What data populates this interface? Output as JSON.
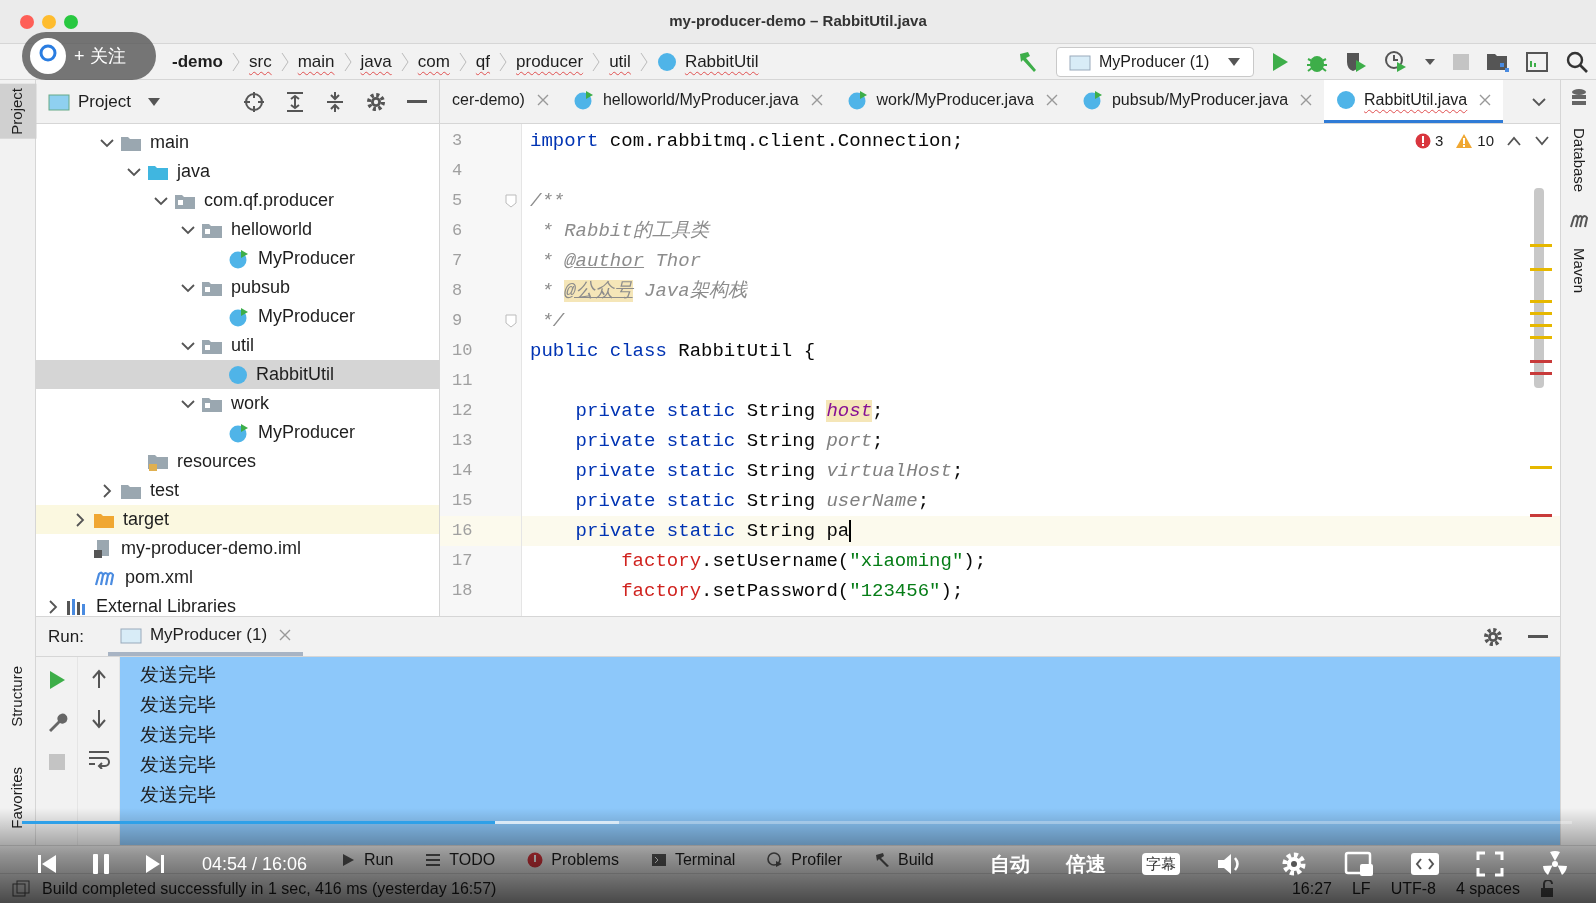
{
  "window": {
    "title": "my-producer-demo – RabbitUtil.java"
  },
  "breadcrumbs": [
    {
      "label": "-demo",
      "kind": "module"
    },
    {
      "label": "src",
      "kind": "folder"
    },
    {
      "label": "main",
      "kind": "folder"
    },
    {
      "label": "java",
      "kind": "folder"
    },
    {
      "label": "com",
      "kind": "folder"
    },
    {
      "label": "qf",
      "kind": "folder"
    },
    {
      "label": "producer",
      "kind": "folder"
    },
    {
      "label": "util",
      "kind": "folder"
    },
    {
      "label": "RabbitUtil",
      "kind": "class"
    }
  ],
  "run_config": {
    "label": "MyProducer (1)"
  },
  "project_panel": {
    "title": "Project",
    "sections": [
      {
        "items": [
          {
            "label": "main",
            "kind": "folder",
            "expanded": true,
            "selected": false,
            "children": [
              {
                "label": "java",
                "kind": "source-folder",
                "expanded": true,
                "selected": false,
                "children": [
                  {
                    "label": "com.qf.producer",
                    "kind": "package",
                    "expanded": true,
                    "selected": false,
                    "children": [
                      {
                        "label": "helloworld",
                        "kind": "package",
                        "expanded": true,
                        "selected": false,
                        "children": [
                          {
                            "label": "MyProducer",
                            "kind": "run-class",
                            "selected": false
                          }
                        ]
                      },
                      {
                        "label": "pubsub",
                        "kind": "package",
                        "expanded": true,
                        "selected": false,
                        "children": [
                          {
                            "label": "MyProducer",
                            "kind": "run-class",
                            "selected": false
                          }
                        ]
                      },
                      {
                        "label": "util",
                        "kind": "package",
                        "expanded": true,
                        "selected": false,
                        "children": [
                          {
                            "label": "RabbitUtil",
                            "kind": "class",
                            "selected": true
                          }
                        ]
                      },
                      {
                        "label": "work",
                        "kind": "package",
                        "expanded": true,
                        "selected": false,
                        "children": [
                          {
                            "label": "MyProducer",
                            "kind": "run-class",
                            "selected": false
                          }
                        ]
                      }
                    ]
                  }
                ]
              },
              {
                "label": "resources",
                "kind": "resources",
                "selected": false
              }
            ]
          },
          {
            "label": "test",
            "kind": "folder",
            "expanded": false,
            "selected": false
          }
        ]
      },
      {
        "items": [
          {
            "label": "target",
            "kind": "excluded-folder",
            "expanded": false,
            "selected": false
          },
          {
            "label": "my-producer-demo.iml",
            "kind": "iml",
            "selected": false
          },
          {
            "label": "pom.xml",
            "kind": "maven",
            "selected": false
          }
        ]
      },
      {
        "items": [
          {
            "label": "External Libraries",
            "kind": "library",
            "expanded": false,
            "selected": false
          }
        ]
      }
    ]
  },
  "editor_tabs": [
    {
      "label": "cer-demo)",
      "kind": "plain",
      "selected": false
    },
    {
      "label": "helloworld/MyProducer.java",
      "kind": "run-class",
      "selected": false
    },
    {
      "label": "work/MyProducer.java",
      "kind": "run-class",
      "selected": false
    },
    {
      "label": "pubsub/MyProducer.java",
      "kind": "run-class",
      "selected": false
    },
    {
      "label": "RabbitUtil.java",
      "kind": "class",
      "selected": true
    }
  ],
  "inspections": {
    "errors": "3",
    "warnings": "10"
  },
  "code_lines": [
    {
      "number": "3",
      "current": false,
      "tokens": [
        {
          "text": "import",
          "kind": "keyword"
        },
        {
          "text": " com.rabbitmq.client.Connection;",
          "kind": "plain"
        }
      ]
    },
    {
      "number": "4",
      "current": false
    },
    {
      "number": "5",
      "current": false,
      "fold": true,
      "tokens": [
        {
          "text": "/**",
          "kind": "comment"
        }
      ]
    },
    {
      "number": "6",
      "current": false,
      "tokens": [
        {
          "text": " * Rabbit的工具类",
          "kind": "comment"
        }
      ]
    },
    {
      "number": "7",
      "current": false,
      "tokens": [
        {
          "text": " * ",
          "kind": "comment"
        },
        {
          "text": "@author",
          "kind": "doctag"
        },
        {
          "text": " Thor",
          "kind": "comment"
        }
      ]
    },
    {
      "number": "8",
      "current": false,
      "tokens": [
        {
          "text": " * ",
          "kind": "comment"
        },
        {
          "text": "@公众号",
          "kind": "unknown-tag"
        },
        {
          "text": " Java架构栈",
          "kind": "comment"
        }
      ]
    },
    {
      "number": "9",
      "current": false,
      "fold": true,
      "tokens": [
        {
          "text": " */",
          "kind": "comment"
        }
      ]
    },
    {
      "number": "10",
      "current": false,
      "tokens": [
        {
          "text": "public class",
          "kind": "keyword"
        },
        {
          "text": " RabbitUtil {",
          "kind": "plain"
        }
      ]
    },
    {
      "number": "11",
      "current": false
    },
    {
      "number": "12",
      "current": false,
      "tokens": [
        {
          "text": "    private static",
          "kind": "keyword"
        },
        {
          "text": " String ",
          "kind": "plain"
        },
        {
          "text": "host",
          "kind": "field-highlight"
        },
        {
          "text": ";",
          "kind": "plain"
        }
      ]
    },
    {
      "number": "13",
      "current": false,
      "tokens": [
        {
          "text": "    private static",
          "kind": "keyword"
        },
        {
          "text": " String ",
          "kind": "plain"
        },
        {
          "text": "port",
          "kind": "field"
        },
        {
          "text": ";",
          "kind": "plain"
        }
      ]
    },
    {
      "number": "14",
      "current": false,
      "tokens": [
        {
          "text": "    private static",
          "kind": "keyword"
        },
        {
          "text": " String ",
          "kind": "plain"
        },
        {
          "text": "virtualHost",
          "kind": "field"
        },
        {
          "text": ";",
          "kind": "plain"
        }
      ]
    },
    {
      "number": "15",
      "current": false,
      "tokens": [
        {
          "text": "    private static",
          "kind": "keyword"
        },
        {
          "text": " String ",
          "kind": "plain"
        },
        {
          "text": "userName",
          "kind": "field"
        },
        {
          "text": ";",
          "kind": "plain"
        }
      ]
    },
    {
      "number": "16",
      "current": true,
      "tokens": [
        {
          "text": "    private static",
          "kind": "keyword"
        },
        {
          "text": " String pa",
          "kind": "plain"
        }
      ]
    },
    {
      "number": "17",
      "current": false,
      "tokens": [
        {
          "text": "        factory",
          "kind": "error"
        },
        {
          "text": ".setUsername(",
          "kind": "plain"
        },
        {
          "text": "\"xiaoming\"",
          "kind": "string"
        },
        {
          "text": ");",
          "kind": "plain"
        }
      ]
    },
    {
      "number": "18",
      "current": false,
      "tokens": [
        {
          "text": "        factory",
          "kind": "error"
        },
        {
          "text": ".setPassword(",
          "kind": "plain"
        },
        {
          "text": "\"123456\"",
          "kind": "string"
        },
        {
          "text": ");",
          "kind": "plain"
        }
      ]
    }
  ],
  "left_stripe": [
    {
      "label": "Project",
      "selected": true
    },
    {
      "label": "Structure",
      "selected": false
    },
    {
      "label": "Favorites",
      "selected": false
    }
  ],
  "right_stripe": [
    {
      "label": "Database",
      "selected": false
    },
    {
      "label": "Maven",
      "selected": false
    }
  ],
  "run_panel": {
    "label": "Run:",
    "tab": "MyProducer (1)",
    "output": [
      "发送完毕",
      "发送完毕",
      "发送完毕",
      "发送完毕",
      "发送完毕"
    ]
  },
  "tool_windows": [
    {
      "label": "Run",
      "kind": "run"
    },
    {
      "label": "TODO",
      "kind": "todo"
    },
    {
      "label": "Problems",
      "kind": "problems"
    },
    {
      "label": "Terminal",
      "kind": "terminal"
    },
    {
      "label": "Profiler",
      "kind": "profiler"
    },
    {
      "label": "Build",
      "kind": "build"
    }
  ],
  "status_bar": {
    "message": "Build completed successfully in 1 sec, 416 ms (yesterday 16:57)",
    "items": [
      "16:27",
      "LF",
      "UTF-8",
      "4 spaces"
    ]
  },
  "player": {
    "follow": "+ 关注",
    "time": "04:54 / 16:06",
    "quality": "自动",
    "speed": "倍速",
    "subtitles": "字幕",
    "progress": {
      "level": 0.305
    },
    "buffer": {
      "level": 0.385
    }
  }
}
